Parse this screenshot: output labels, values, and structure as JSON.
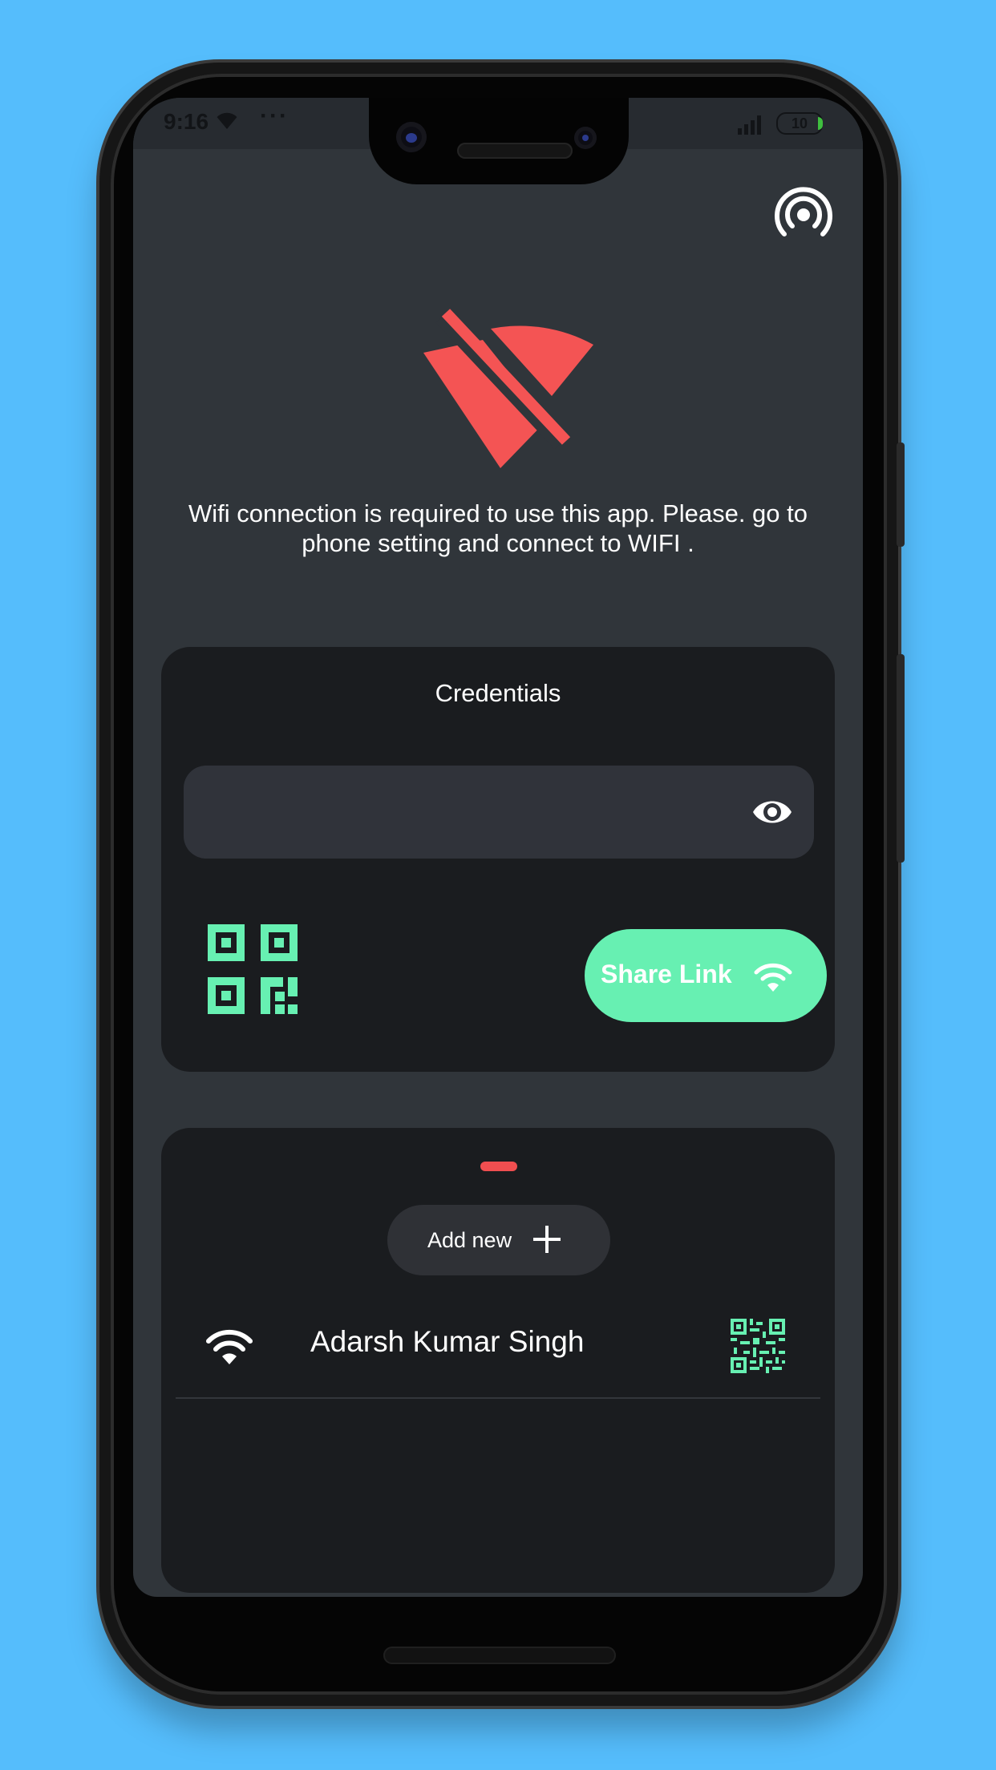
{
  "status_bar": {
    "time": "9:16",
    "dots": "···",
    "battery": "10"
  },
  "message": {
    "text": "Wifi connection is required to use this app. Please. go to phone setting and connect to WIFI ."
  },
  "credentials_card": {
    "title": "Credentials",
    "password_value": "",
    "share_button_label": "Share Link"
  },
  "networks_card": {
    "add_button_label": "Add new",
    "networks": [
      {
        "name": "Adarsh Kumar Singh"
      }
    ]
  },
  "colors": {
    "background": "#55bdfc",
    "screen": "#30353a",
    "card": "#1a1c1f",
    "accent_green": "#67f0b2",
    "alert_red": "#f45454"
  },
  "icons": {
    "top_right": "hotspot-icon",
    "hero": "wifi-off-icon",
    "password_toggle": "eye-icon",
    "qr": "qr-code-icon",
    "share": "wifi-icon",
    "add": "plus-icon"
  }
}
